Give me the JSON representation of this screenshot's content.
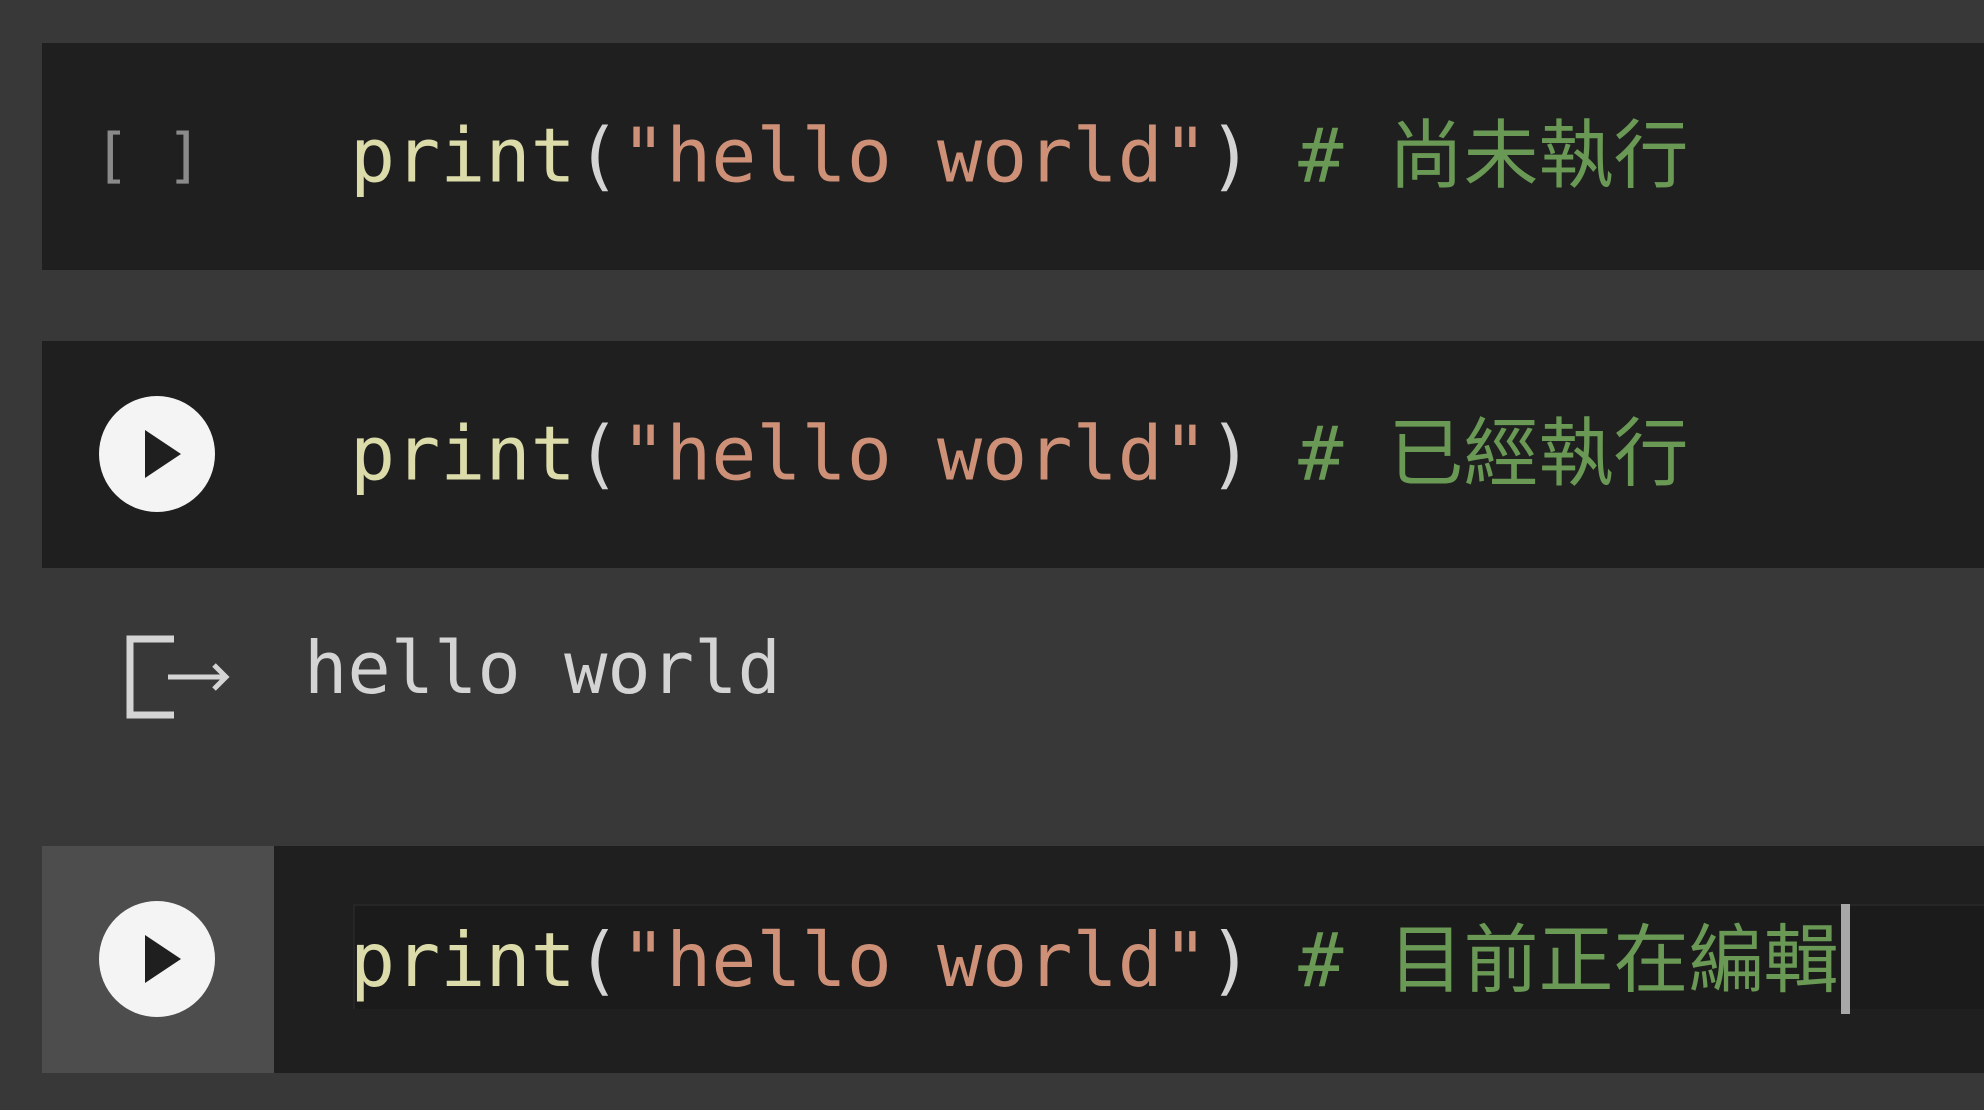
{
  "cells": [
    {
      "status": "not-run",
      "exec_count": "[ ]",
      "code": {
        "fn": "print",
        "open_paren": "(",
        "string": "\"hello world\"",
        "close_paren": ")",
        "comment": " # 尚未執行"
      }
    },
    {
      "status": "executed",
      "run_icon": "play-icon",
      "code": {
        "fn": "print",
        "open_paren": "(",
        "string": "\"hello world\"",
        "close_paren": ")",
        "comment": " # 已經執行"
      },
      "output": {
        "icon": "output-arrow-icon",
        "text": "hello world"
      }
    },
    {
      "status": "editing",
      "run_icon": "play-icon",
      "code": {
        "fn": "print",
        "open_paren": "(",
        "string": "\"hello world\"",
        "close_paren": ")",
        "comment": " # 目前正在編輯"
      }
    }
  ],
  "colors": {
    "background": "#383838",
    "cell_background": "#1f1f1f",
    "active_gutter": "#4d4d4d",
    "function": "#dcdcaa",
    "string": "#ce9178",
    "comment": "#6a9955",
    "paren": "#d4d4d4",
    "run_button": "#f4f4f4"
  }
}
